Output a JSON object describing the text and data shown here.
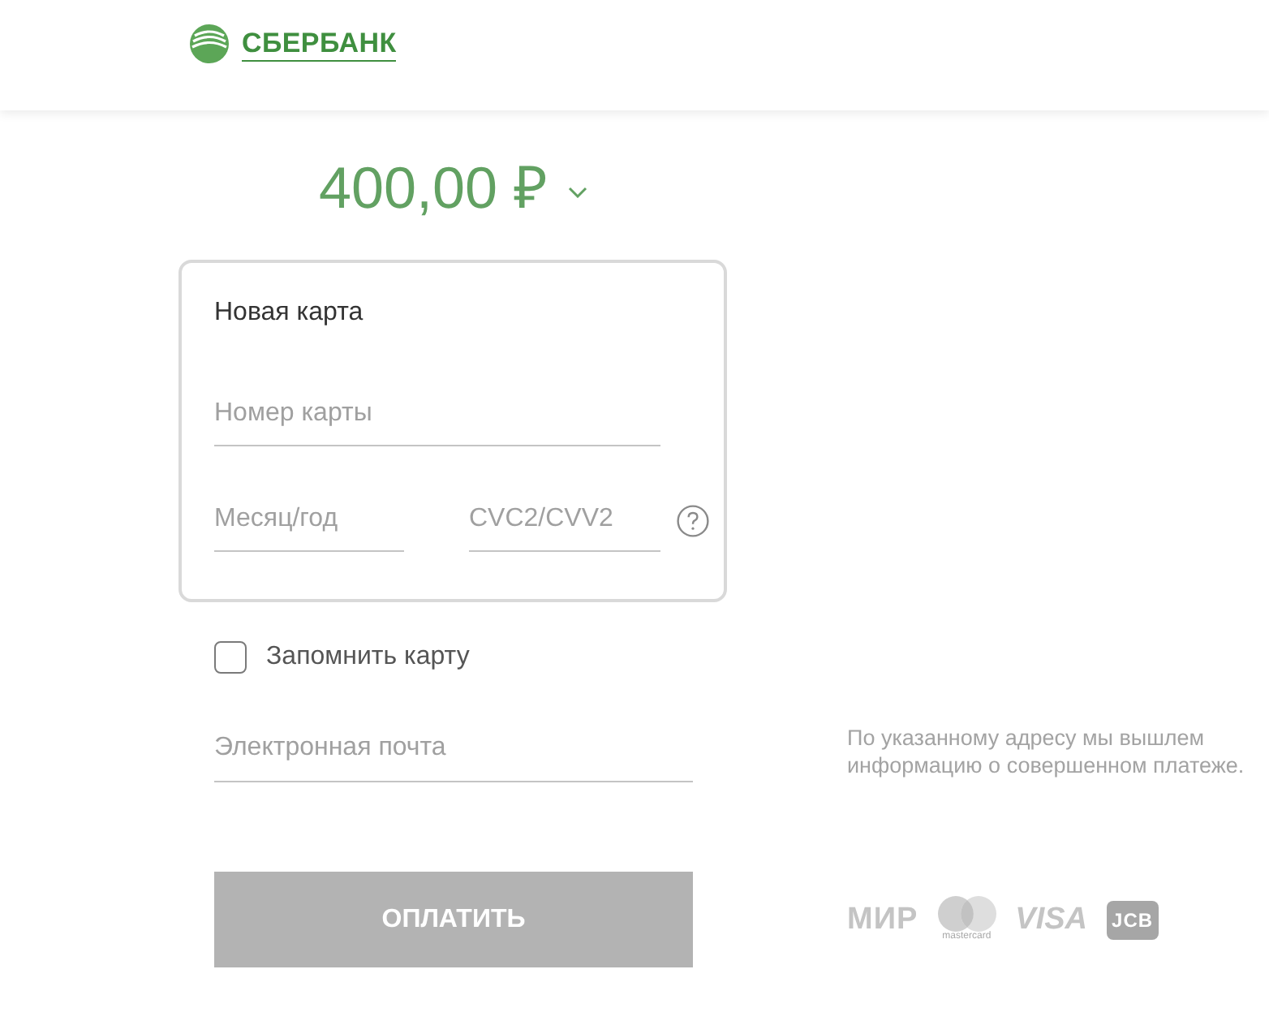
{
  "header": {
    "logo_text": "СБЕРБАНК"
  },
  "amount": {
    "value": "400,00 ₽"
  },
  "card_form": {
    "title": "Новая карта",
    "card_number": {
      "placeholder": "Номер карты"
    },
    "expiry": {
      "placeholder": "Месяц/год"
    },
    "cvc": {
      "placeholder": "CVC2/CVV2"
    }
  },
  "remember_card": {
    "label": "Запомнить карту",
    "checked": false
  },
  "email": {
    "placeholder": "Электронная почта"
  },
  "email_note": "По указанному адресу мы вышлем информацию о совершенном платеже.",
  "pay_button": {
    "label": "ОПЛАТИТЬ",
    "disabled": true
  },
  "payment_logos": [
    {
      "kind": "mir",
      "text": "МИР"
    },
    {
      "kind": "mastercard",
      "text": "mastercard"
    },
    {
      "kind": "visa",
      "text": "VISA"
    },
    {
      "kind": "jcb",
      "text": "JCB"
    }
  ]
}
